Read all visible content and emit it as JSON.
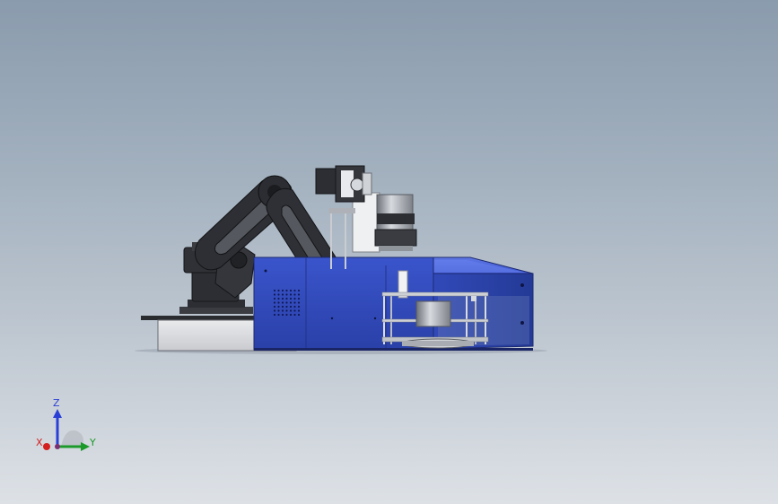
{
  "triad": {
    "z_label": "Z",
    "y_label": "Y",
    "x_label": "X"
  },
  "colors": {
    "background_top": "#8a9bad",
    "background_bottom": "#dde1e6",
    "enclosure_blue": "#3550c8",
    "arm_black": "#2b2d31",
    "axis_z": "#2a3fd6",
    "axis_y": "#1b9a2a",
    "axis_x": "#d52020"
  }
}
